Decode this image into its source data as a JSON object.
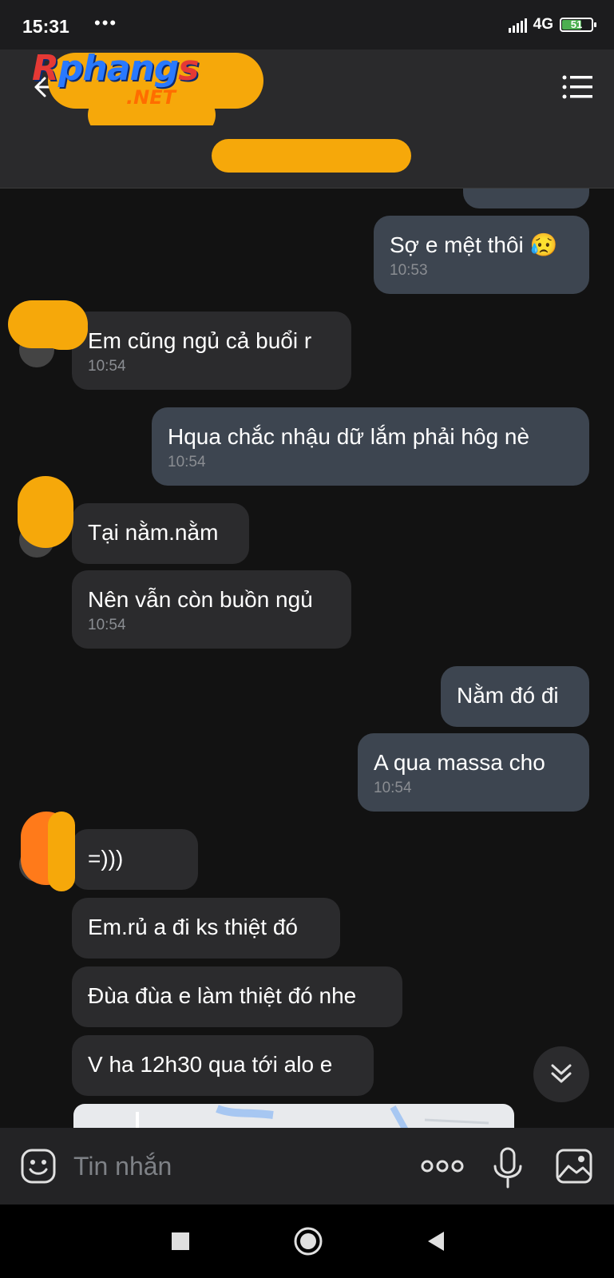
{
  "status": {
    "time": "15:31",
    "dots": "•••",
    "network": "4G",
    "battery": "51"
  },
  "logo": {
    "main": "phang",
    "first_letter": "R",
    "last_letter": "s",
    "suffix": ".NET"
  },
  "messages": [
    {
      "dir": "out",
      "text": "",
      "time": ""
    },
    {
      "dir": "out",
      "text": "Sợ e mệt thôi 😥",
      "time": "10:53"
    },
    {
      "dir": "in",
      "text": "Em cũng ngủ cả buổi r",
      "time": "10:54"
    },
    {
      "dir": "out",
      "text": "Hqua chắc nhậu dữ lắm phải hôg nè",
      "time": "10:54"
    },
    {
      "dir": "in",
      "text": "Tại nằm.nằm",
      "time": ""
    },
    {
      "dir": "in",
      "text": "Nên vẫn còn buồn ngủ",
      "time": "10:54"
    },
    {
      "dir": "out",
      "text": "Nằm đó đi",
      "time": ""
    },
    {
      "dir": "out",
      "text": "A qua massa cho",
      "time": "10:54"
    },
    {
      "dir": "in",
      "text": "=)))",
      "time": ""
    },
    {
      "dir": "in",
      "text": "Em.rủ a đi ks thiệt đó",
      "time": ""
    },
    {
      "dir": "in",
      "text": "Đùa đùa e làm thiệt đó nhe",
      "time": ""
    },
    {
      "dir": "in",
      "text": "V ha 12h30 qua tới alo e",
      "time": ""
    }
  ],
  "input": {
    "placeholder": "Tin nhắn"
  },
  "icons": {
    "back": "back-arrow-icon",
    "menu": "menu-list-icon",
    "emoji": "emoji-icon",
    "more": "more-icon",
    "mic": "microphone-icon",
    "gallery": "image-icon",
    "scroll_down": "double-chevron-down-icon"
  },
  "colors": {
    "background": "#121212",
    "bubble_in": "#2b2b2d",
    "bubble_out": "#3d4550",
    "timestamp": "#8a8d92",
    "redaction": "#f6a80a"
  }
}
